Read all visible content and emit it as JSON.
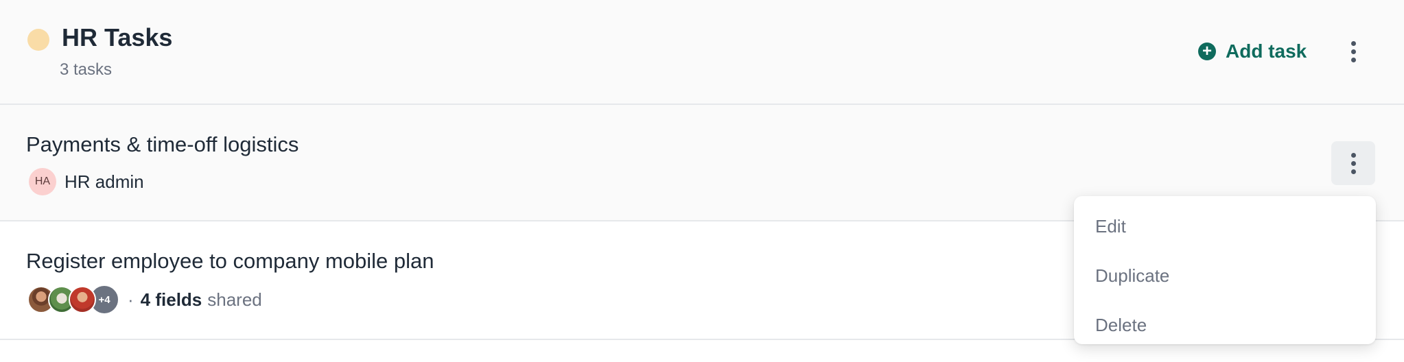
{
  "group": {
    "title": "HR Tasks",
    "count": "3 tasks",
    "dot_color": "#f9dca7",
    "add_task_label": "Add task",
    "accent": "#0f6b5d"
  },
  "tasks": [
    {
      "title": "Payments & time-off logistics",
      "assignee": {
        "initials": "HA",
        "name": "HR admin"
      }
    },
    {
      "title": "Register employee to company mobile plan",
      "avatars_more": "+4",
      "separator": "·",
      "fields_count": "4 fields",
      "fields_suffix": "shared"
    }
  ],
  "menu": {
    "items": [
      {
        "label": "Edit"
      },
      {
        "label": "Duplicate"
      },
      {
        "label": "Delete"
      }
    ]
  }
}
